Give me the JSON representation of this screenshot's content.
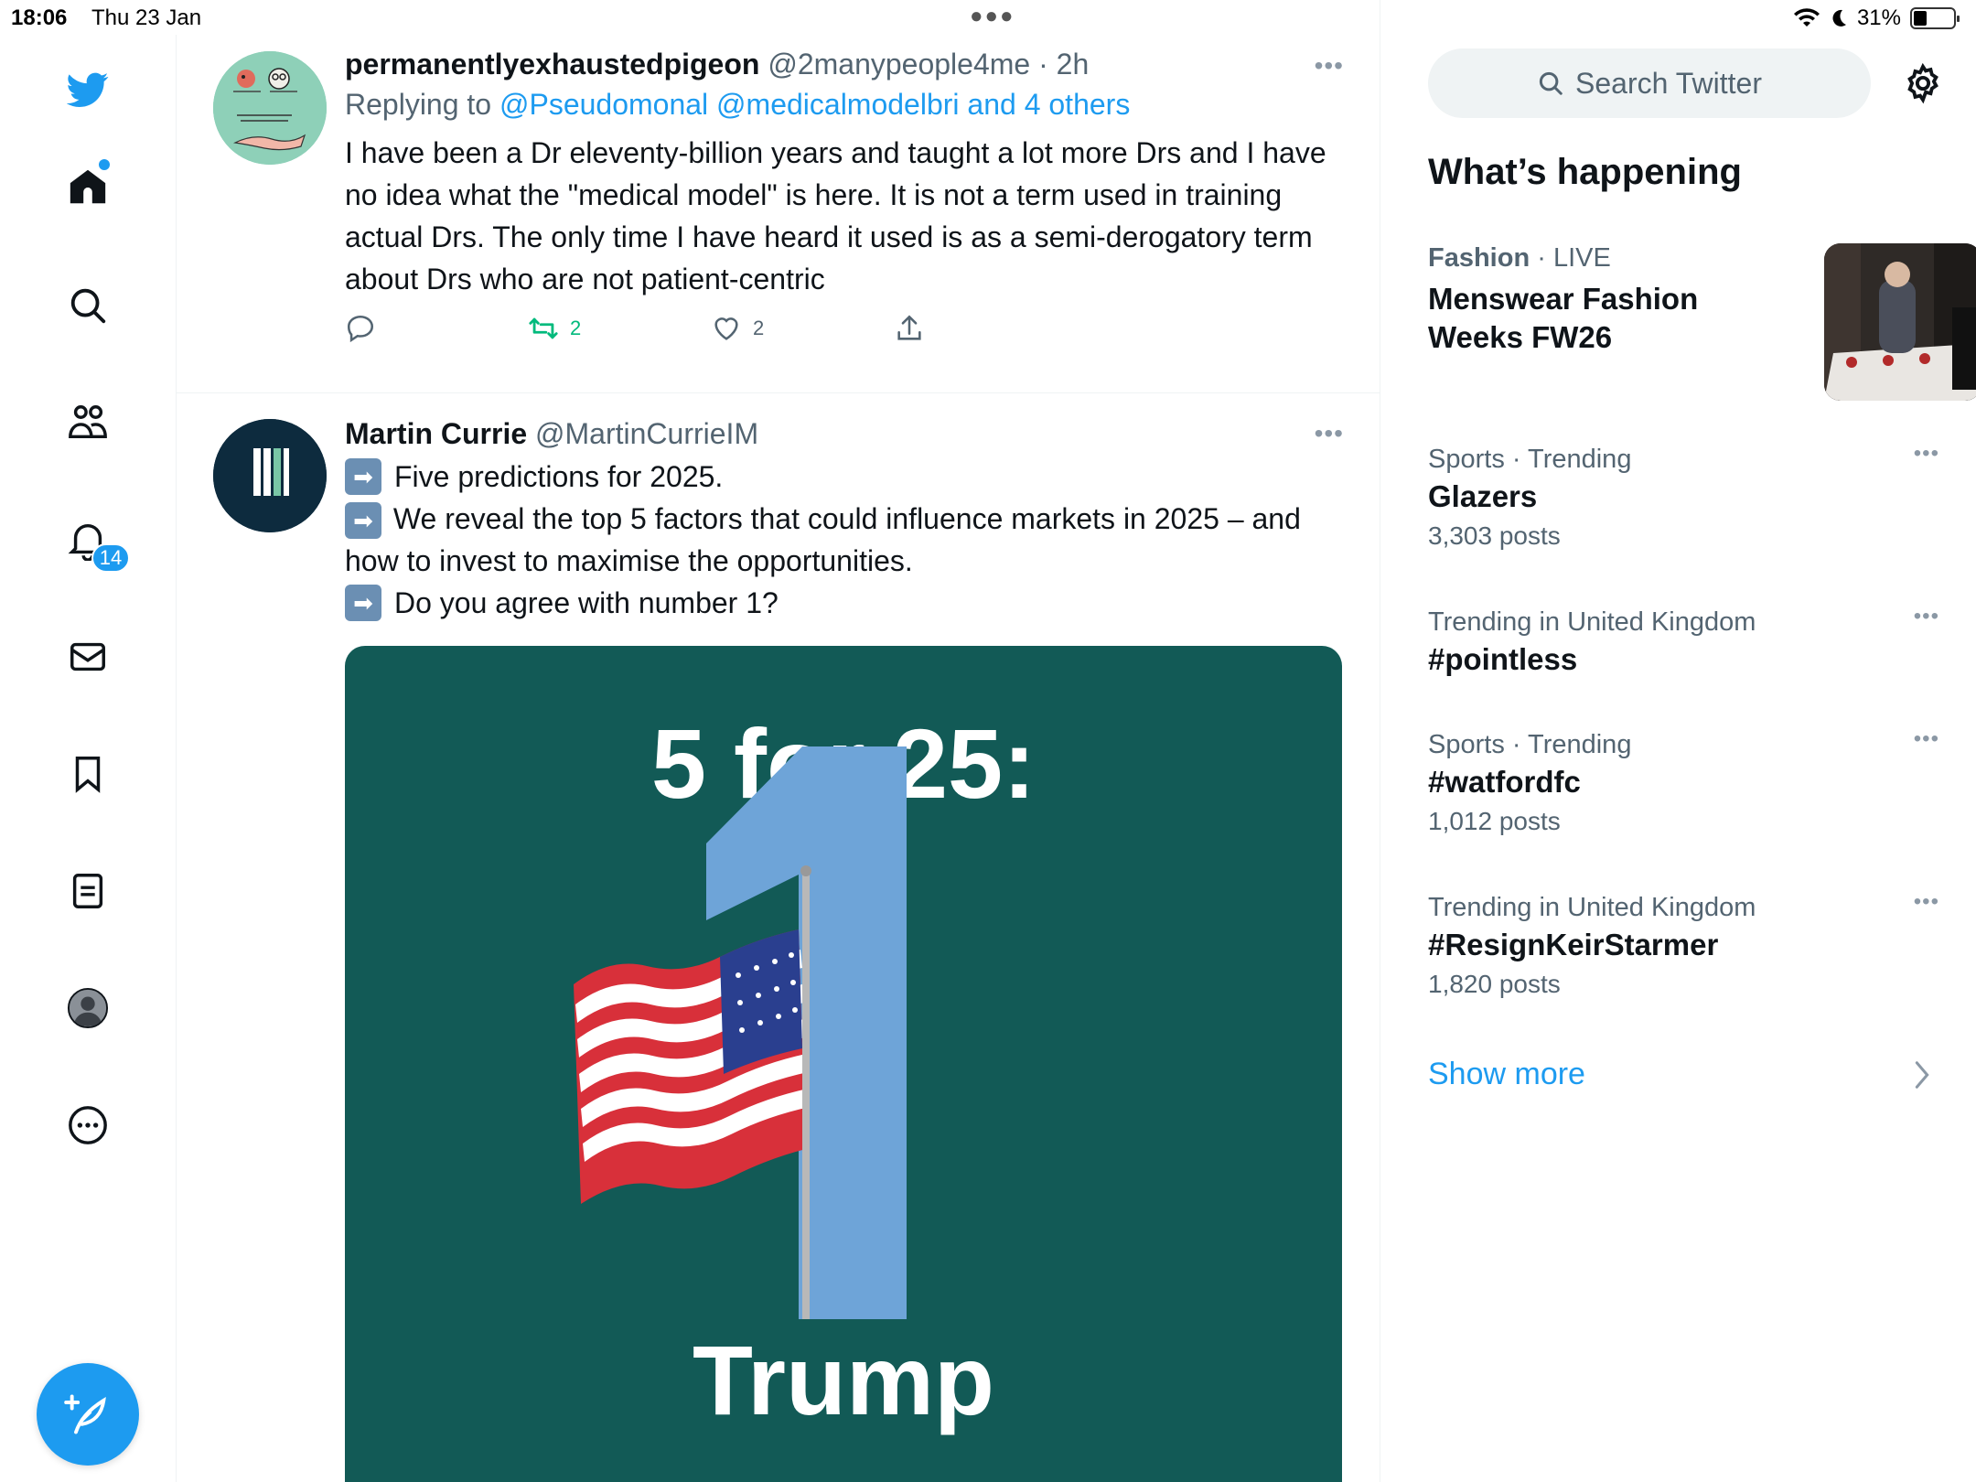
{
  "status": {
    "time": "18:06",
    "date": "Thu 23 Jan",
    "battery": "31%"
  },
  "colors": {
    "accent": "#1d9bf0",
    "retweet": "#00ba7c",
    "media_bg": "#125a56"
  },
  "nav": {
    "icons": [
      "twitter-bird-icon",
      "home-icon",
      "search-icon",
      "communities-icon",
      "notifications-icon",
      "messages-icon",
      "bookmarks-icon",
      "lists-icon",
      "profile-icon",
      "more-icon"
    ],
    "notification_count": "14"
  },
  "tweets": [
    {
      "name": "permanentlyexhaustedpigeon",
      "handle": "@2manypeople4me",
      "sep": " · ",
      "time": "2h",
      "replying_prefix": "Replying to ",
      "replying_links": "@Pseudomonal @medicalmodelbri and 4 others",
      "text": "I have been a Dr eleventy-billion years and taught a lot more Drs and I have no idea what the \"medical model\" is here. It is not a term used in training actual Drs. The only time I have heard it used is as a semi-derogatory term about Drs who are not patient-centric",
      "retweets": "2",
      "likes": "2"
    },
    {
      "name": "Martin Currie",
      "handle": "@MartinCurrieIM",
      "lines": [
        "Five predictions for 2025.",
        "We reveal the top 5 factors that could influence markets in 2025 – and how to invest to maximise the opportunities.",
        "Do you agree with number 1?"
      ],
      "media_title": "5 for 25:",
      "media_caption": "Trump",
      "media_number": "1"
    }
  ],
  "sidebar": {
    "search_placeholder": "Search Twitter",
    "section_title": "What’s happening",
    "trends": [
      {
        "category": "Fashion",
        "sep": " · ",
        "status": "LIVE",
        "title": "Menswear Fashion Weeks FW26"
      },
      {
        "meta": "Sports · Trending",
        "title": "Glazers",
        "count": "3,303 posts"
      },
      {
        "meta": "Trending in United Kingdom",
        "title": "#pointless"
      },
      {
        "meta": "Sports · Trending",
        "title": "#watfordfc",
        "count": "1,012 posts"
      },
      {
        "meta": "Trending in United Kingdom",
        "title": "#ResignKeirStarmer",
        "count": "1,820 posts"
      }
    ],
    "show_more": "Show more"
  }
}
